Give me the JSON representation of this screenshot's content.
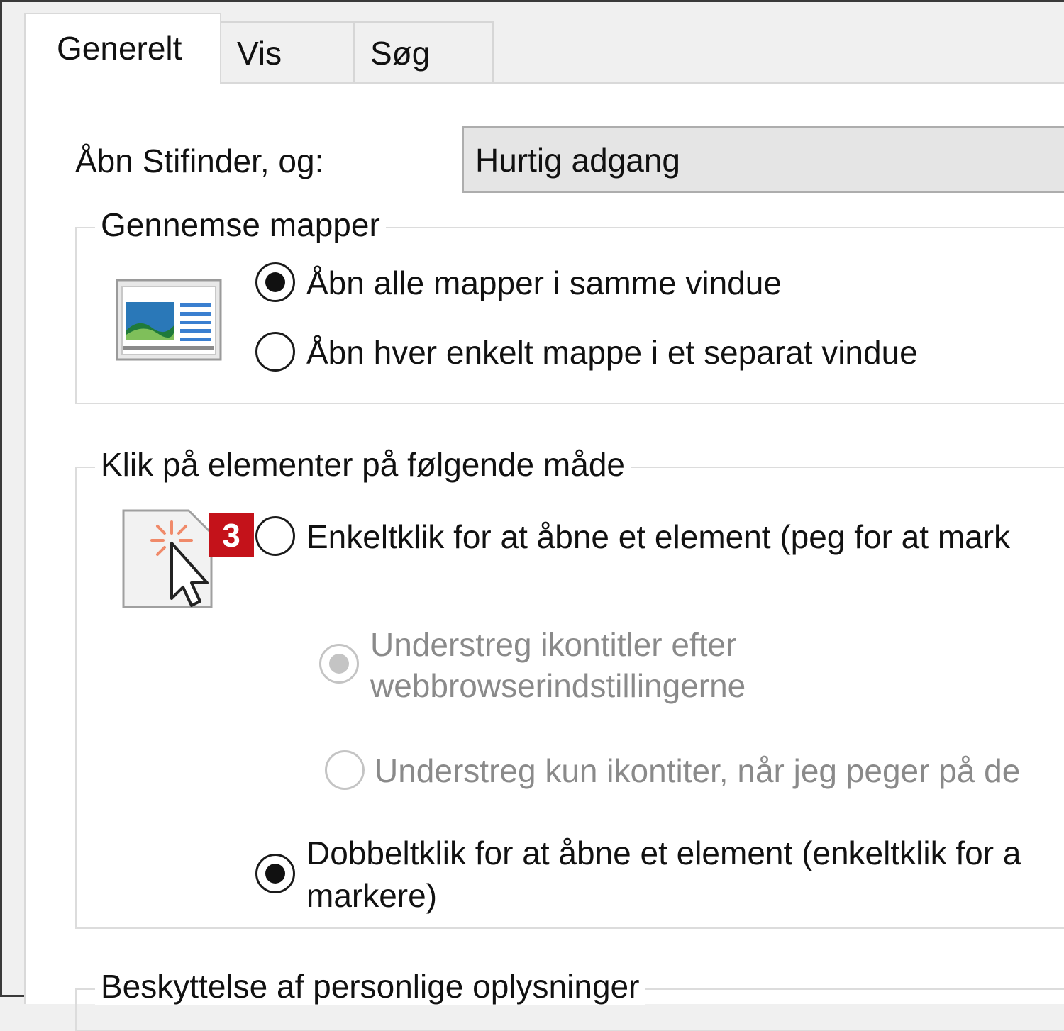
{
  "tabs": [
    {
      "label": "Generelt",
      "active": true
    },
    {
      "label": "Vis",
      "active": false
    },
    {
      "label": "Søg",
      "active": false
    }
  ],
  "open_explorer": {
    "label": "Åbn Stifinder, og:",
    "value": "Hurtig adgang"
  },
  "browse_folders": {
    "title": "Gennemse mapper",
    "icon": "folder-window-icon",
    "options": [
      {
        "label": "Åbn alle mapper i samme vindue",
        "selected": true
      },
      {
        "label": "Åbn hver enkelt mappe i et separat vindue",
        "selected": false
      }
    ]
  },
  "click_items": {
    "title": "Klik på elementer på følgende måde",
    "icon": "click-cursor-icon",
    "badge": "3",
    "single_click": {
      "label": "Enkeltklik for at åbne et element (peg for at mark",
      "selected": false
    },
    "underline_browser": {
      "line1": "Understreg ikontitler efter",
      "line2": "webbrowserindstillingerne",
      "selected": true,
      "disabled": true
    },
    "underline_hover": {
      "label": "Understreg kun ikontiter, når jeg peger på de",
      "selected": false,
      "disabled": true
    },
    "double_click": {
      "line1": "Dobbeltklik for at åbne et element (enkeltklik for a",
      "line2": "markere)",
      "selected": true
    }
  },
  "privacy": {
    "title": "Beskyttelse af personlige oplysninger"
  },
  "colors": {
    "badge": "#c4121a",
    "panel": "#ffffff",
    "background": "#f0f0f0"
  }
}
